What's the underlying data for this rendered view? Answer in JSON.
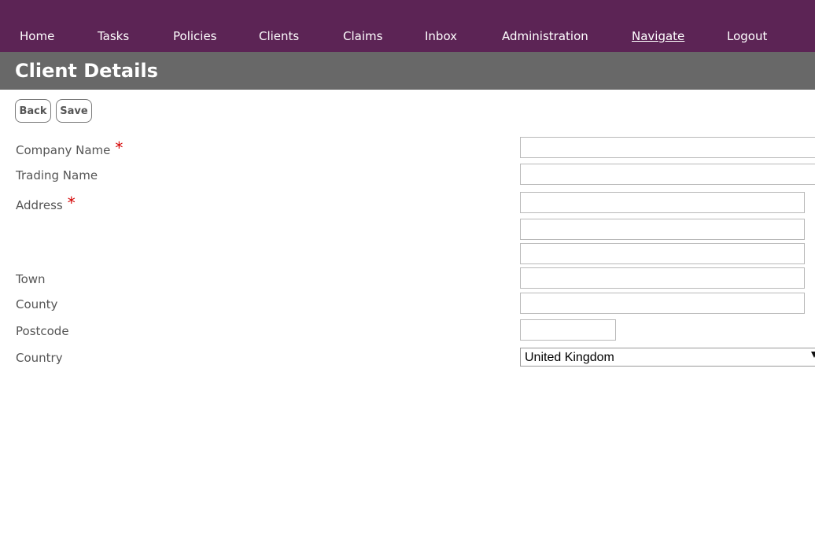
{
  "nav": {
    "items": [
      {
        "label": "Home"
      },
      {
        "label": "Tasks"
      },
      {
        "label": "Policies"
      },
      {
        "label": "Clients"
      },
      {
        "label": "Claims"
      },
      {
        "label": "Inbox"
      },
      {
        "label": "Administration"
      },
      {
        "label": "Navigate",
        "active": true
      },
      {
        "label": "Logout"
      }
    ]
  },
  "page": {
    "title": "Client Details"
  },
  "actions": {
    "back_label": "Back",
    "save_label": "Save"
  },
  "form": {
    "required_marker": "*",
    "company_name": {
      "label": "Company Name",
      "required": true,
      "value": ""
    },
    "trading_name": {
      "label": "Trading Name",
      "value": ""
    },
    "address": {
      "label": "Address",
      "required": true,
      "lines": [
        "",
        "",
        ""
      ]
    },
    "town": {
      "label": "Town",
      "value": ""
    },
    "county": {
      "label": "County",
      "value": ""
    },
    "postcode": {
      "label": "Postcode",
      "value": ""
    },
    "country": {
      "label": "Country",
      "selected": "United Kingdom",
      "icon": "chevron-down-icon"
    }
  },
  "colors": {
    "nav_background": "#5c2455",
    "title_background": "#686868",
    "required": "#d40000"
  }
}
